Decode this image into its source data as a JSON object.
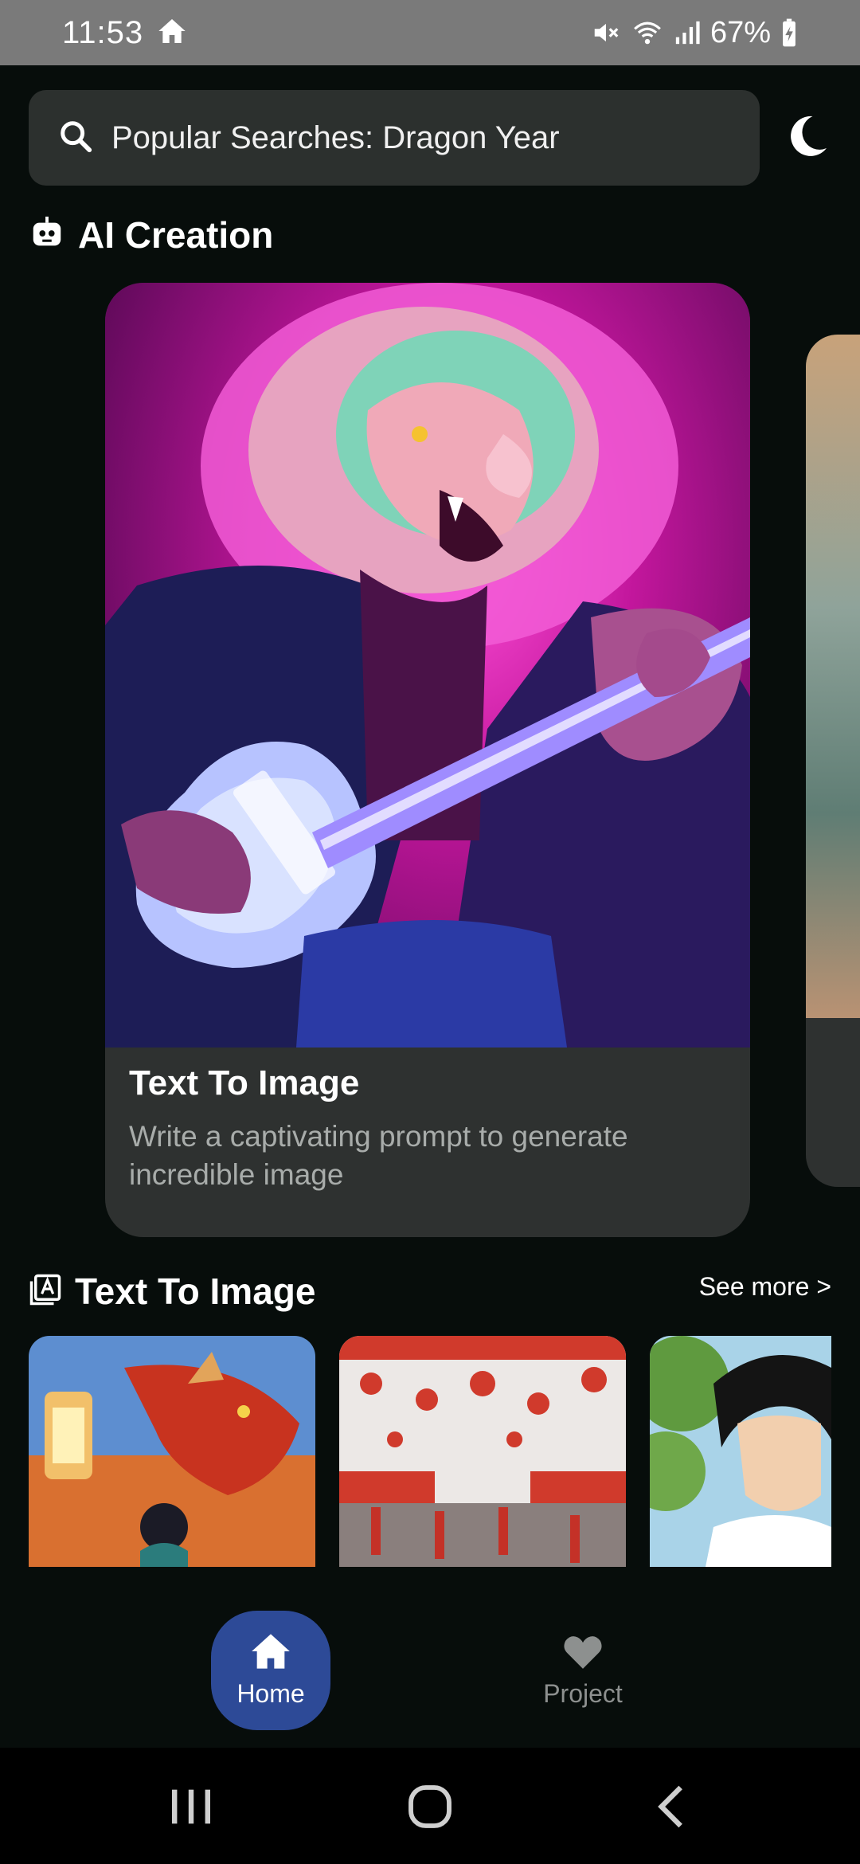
{
  "status_bar": {
    "time": "11:53",
    "battery": "67%",
    "icons": [
      "home-icon",
      "mute-icon",
      "wifi-icon",
      "signal-icon",
      "battery-charging-icon"
    ]
  },
  "search": {
    "text": "Popular Searches: Dragon Year",
    "icon": "search-icon"
  },
  "theme_toggle": {
    "icon": "moon-icon"
  },
  "ai_creation": {
    "title": "AI Creation",
    "icon": "robot-icon",
    "cards": [
      {
        "title": "Text To Image",
        "description": "Write a captivating prompt to generate incredible image",
        "image": "lion-guitarist-art"
      }
    ]
  },
  "text_to_image": {
    "title": "Text To Image",
    "icon": "text-image-icon",
    "see_more": "See more >",
    "thumbnails": [
      "dragon-lantern-art",
      "red-lantern-market-art",
      "anime-portrait-art"
    ]
  },
  "bottom_nav": {
    "items": [
      {
        "label": "Home",
        "icon": "home-icon",
        "active": true
      },
      {
        "label": "Project",
        "icon": "heart-icon",
        "active": false
      }
    ]
  },
  "system_nav": {
    "icons": [
      "recents-icon",
      "home-circle-icon",
      "back-icon"
    ]
  },
  "colors": {
    "background": "#070d0b",
    "surface": "#2c302e",
    "accent": "#2d4a97",
    "muted_text": "#a8acaa"
  }
}
